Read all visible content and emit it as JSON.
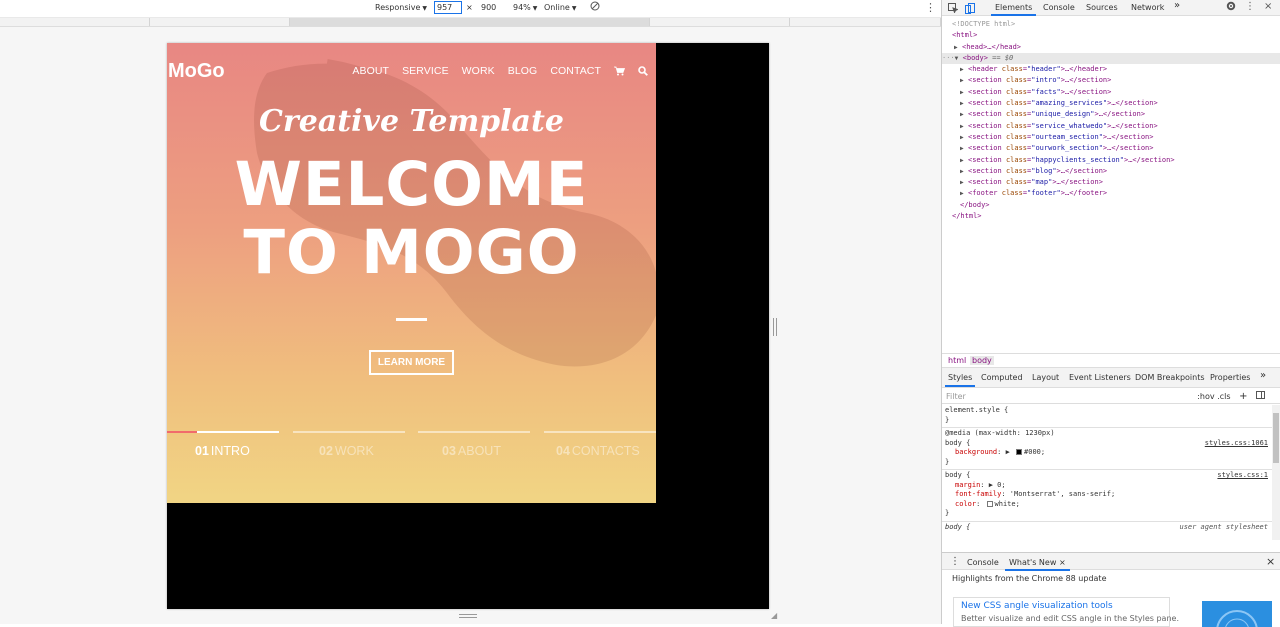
{
  "emulation": {
    "device": "Responsive",
    "width": "957",
    "times": "×",
    "height": "900",
    "zoom": "94%",
    "throttle": "Online"
  },
  "site": {
    "logo": "MoGo",
    "nav": [
      "ABOUT",
      "SERVICE",
      "WORK",
      "BLOG",
      "CONTACT"
    ],
    "hero_script": "Creative Template",
    "hero_line1": "WELCOME",
    "hero_line2": "TO MOGO",
    "cta": "LEARN MORE",
    "slides": [
      {
        "num": "01",
        "label": "INTRO",
        "active": true,
        "progress": 0.27
      },
      {
        "num": "02",
        "label": "WORK",
        "active": false
      },
      {
        "num": "03",
        "label": "ABOUT",
        "active": false
      },
      {
        "num": "04",
        "label": "CONTACTS",
        "active": false
      }
    ],
    "gradient_top": "#e88783",
    "gradient_bottom": "#f1d584",
    "accent": "#f16a6b"
  },
  "devtools": {
    "tabs": [
      "Elements",
      "Console",
      "Sources",
      "Network"
    ],
    "more_tabs": "»",
    "dom": {
      "doctype": "<!DOCTYPE html>",
      "html_open": "html",
      "head": "head",
      "body": "body",
      "body_suffix": "== $0",
      "children": [
        {
          "tag": "header",
          "cls": "header"
        },
        {
          "tag": "section",
          "cls": "intro"
        },
        {
          "tag": "section",
          "cls": "facts"
        },
        {
          "tag": "section",
          "cls": "amazing_services"
        },
        {
          "tag": "section",
          "cls": "unique_design"
        },
        {
          "tag": "section",
          "cls": "service_whatwedo"
        },
        {
          "tag": "section",
          "cls": "ourteam_section"
        },
        {
          "tag": "section",
          "cls": "ourwork_section"
        },
        {
          "tag": "section",
          "cls": "happyclients_section"
        },
        {
          "tag": "section",
          "cls": "blog"
        },
        {
          "tag": "section",
          "cls": "map"
        },
        {
          "tag": "footer",
          "cls": "footer"
        }
      ],
      "body_close": "</body>",
      "html_close": "</html>"
    },
    "breadcrumb": [
      "html",
      "body"
    ],
    "styles_tabs": [
      "Styles",
      "Computed",
      "Layout",
      "Event Listeners",
      "DOM Breakpoints",
      "Properties"
    ],
    "filter_placeholder": "Filter",
    "filter_tools": ":hov  .cls",
    "styles": {
      "element_style": "element.style {",
      "close_brace": "}",
      "media": "@media (max-width: 1230px)",
      "rule1_selector": "body {",
      "rule1_source": "styles.css:1061",
      "rule1_prop": "background",
      "rule1_val": "#000;",
      "rule2_selector": "body {",
      "rule2_source": "styles.css:1",
      "rule2_props": [
        {
          "name": "margin",
          "val": "▶ 0;"
        },
        {
          "name": "font-family",
          "val": "'Montserrat', sans-serif;"
        },
        {
          "name": "color",
          "val": "white;"
        }
      ],
      "rule3_selector": "body {",
      "rule3_source": "user agent stylesheet"
    },
    "drawer": {
      "tabs": [
        "Console",
        "What's New"
      ],
      "close": "×",
      "heading": "Highlights from the Chrome 88 update",
      "card_title": "New CSS angle visualization tools",
      "card_text": "Better visualize and edit CSS angle in the Styles pane."
    }
  }
}
